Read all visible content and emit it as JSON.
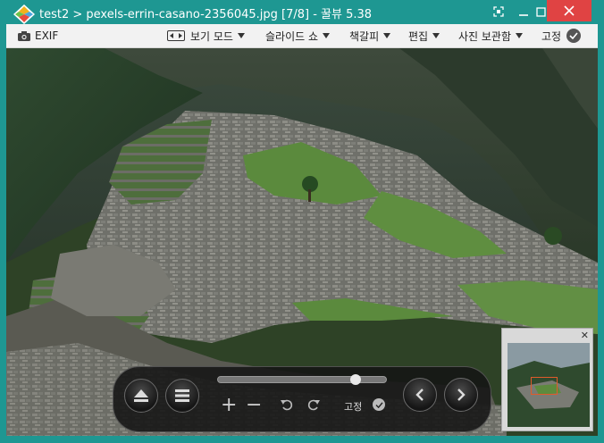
{
  "titlebar": {
    "title": "test2 > pexels-errin-casano-2356045.jpg [7/8] - 꿀뷰 5.38"
  },
  "toolbar": {
    "exif_label": "EXIF",
    "view_mode_label": "보기 모드",
    "slideshow_label": "슬라이드 쇼",
    "bookmark_label": "책갈피",
    "edit_label": "편집",
    "photo_save_label": "사진 보관함",
    "pin_label": "고정"
  },
  "controls": {
    "slider_fraction": 0.82,
    "zoom_in_glyph": "+",
    "zoom_out_glyph": "−",
    "pin_label": "고정"
  },
  "navigator": {
    "close_glyph": "✕"
  },
  "colors": {
    "titlebar": "#1e9792",
    "close_button": "#e04343",
    "toolbar_bg": "#f2f2f2",
    "nav_highlight": "#e05a2a"
  }
}
